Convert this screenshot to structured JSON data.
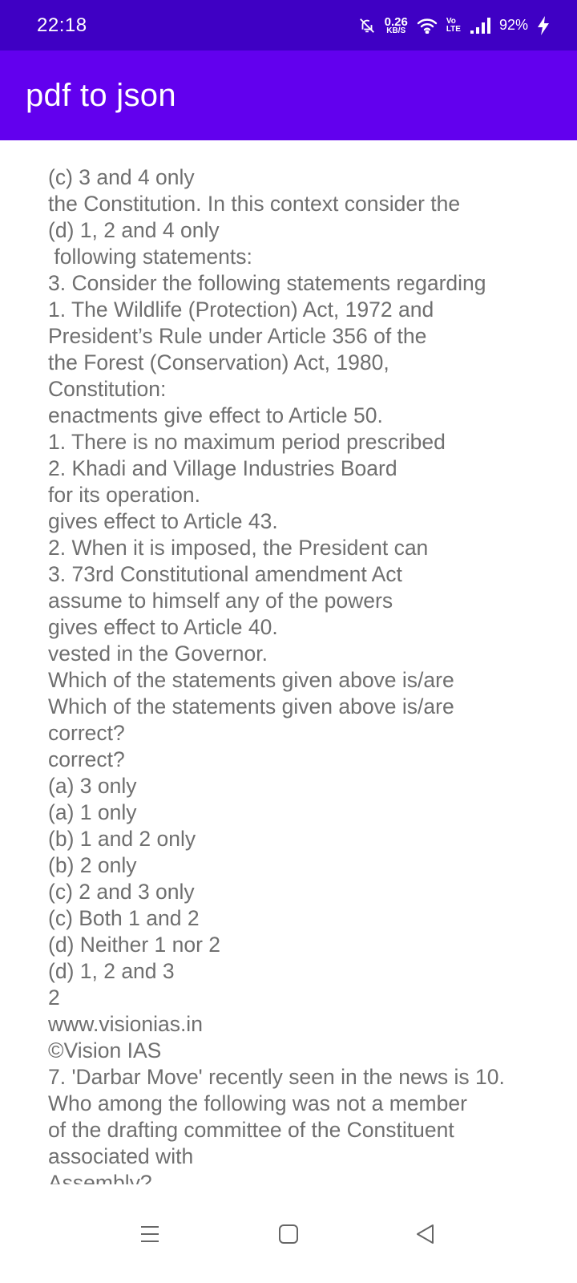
{
  "status_bar": {
    "time": "22:18",
    "net_speed_value": "0.26",
    "net_speed_unit": "KB/S",
    "volte_top": "Vo",
    "volte_bottom": "LTE",
    "battery": "92%",
    "icons": [
      "mute-bell-icon",
      "wifi-icon",
      "signal-icon",
      "charging-icon"
    ]
  },
  "app_bar": {
    "title": "pdf to json",
    "color": "#6200EE"
  },
  "content": {
    "text": "(c) 3 and 4 only\nthe Constitution. In this context consider the\n(d) 1, 2 and 4 only\n following statements:\n3. Consider the following statements regarding\n1. The Wildlife (Protection) Act, 1972 and\nPresident’s Rule under Article 356 of the\nthe Forest (Conservation) Act, 1980,\nConstitution:\nenactments give effect to Article 50.\n1. There is no maximum period prescribed\n2. Khadi and Village Industries Board\nfor its operation.\ngives effect to Article 43.\n2. When it is imposed, the President can\n3. 73rd Constitutional amendment Act\nassume to himself any of the powers\ngives effect to Article 40.\nvested in the Governor.\nWhich of the statements given above is/are\nWhich of the statements given above is/are\ncorrect?\ncorrect?\n(a) 3 only\n(a) 1 only\n(b) 1 and 2 only\n(b) 2 only\n(c) 2 and 3 only\n(c) Both 1 and 2\n(d) Neither 1 nor 2\n(d) 1, 2 and 3\n2\nwww.visionias.in\n©Vision IAS\n7. 'Darbar Move' recently seen in the news is 10.\nWho among the following was not a member\nof the drafting committee of the Constituent\nassociated with\nAssembly?"
  },
  "nav_bar": {
    "icons": [
      "menu-icon",
      "home-icon",
      "back-icon"
    ]
  }
}
